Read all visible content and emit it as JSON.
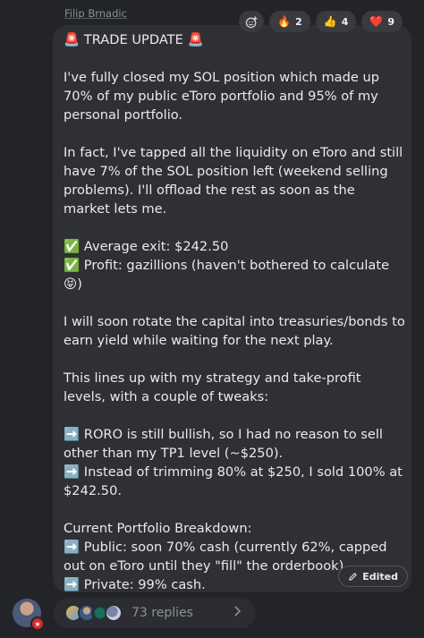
{
  "author": "Filip Brnadic",
  "reactions": [
    {
      "emoji": "🔥",
      "count": "2"
    },
    {
      "emoji": "👍",
      "count": "4"
    },
    {
      "emoji": "❤️",
      "count": "9"
    }
  ],
  "message": {
    "title": "🚨 TRADE UPDATE 🚨",
    "p1": "I've fully closed my SOL position which made up 70% of my public eToro portfolio and 95% of my personal portfolio.",
    "p2": "In fact, I've tapped all the liquidity on eToro and still have 7% of the SOL position left (weekend selling problems). I'll offload the rest as soon as the market lets me.",
    "exit_line": "✅ Average exit: $242.50",
    "profit_line": "✅ Profit: gazillions (haven't bothered to calculate 😝)",
    "p3": "I will soon rotate the capital into treasuries/bonds to earn yield while waiting for the next play.",
    "p4": "This lines up with my strategy and take-profit levels, with a couple of tweaks:",
    "bullet1": "➡️ RORO is still bullish, so I had no reason to sell other than my TP1 level (~$250).",
    "bullet2": "➡️ Instead of trimming 80% at $250, I sold 100% at $242.50.",
    "breakdown_title": "Current Portfolio Breakdown:",
    "public_line": "➡️ Public: soon 70% cash (currently 62%, capped out on eToro until they \"fill\" the orderbook).",
    "private_line": "➡️ Private: 99% cash."
  },
  "edited_label": "Edited",
  "replies_label": "73 replies",
  "colors": {
    "background": "#232428",
    "bubble": "#2f3035",
    "pill": "#3a3b40",
    "text": "#e9eaee",
    "muted": "#8b8f96",
    "badge": "#d62a2a"
  }
}
